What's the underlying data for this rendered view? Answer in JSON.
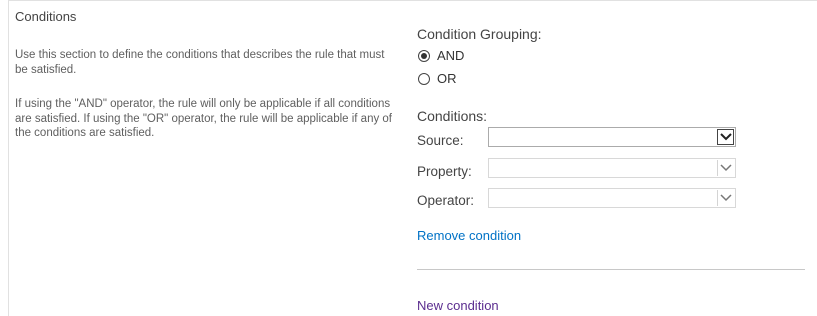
{
  "section": {
    "title": "Conditions",
    "description_1": "Use this section to define the conditions that describes the rule that must be satisfied.",
    "description_2": "If using the \"AND\" operator, the rule will only be applicable if all conditions are satisfied. If using the \"OR\" operator, the rule will be applicable if any of the conditions are satisfied."
  },
  "grouping": {
    "label": "Condition Grouping:",
    "options": [
      {
        "label": "AND",
        "selected": true
      },
      {
        "label": "OR",
        "selected": false
      }
    ]
  },
  "conditions": {
    "label": "Conditions:",
    "fields": {
      "source": {
        "label": "Source:",
        "value": "",
        "enabled": true
      },
      "property": {
        "label": "Property:",
        "value": "",
        "enabled": false
      },
      "operator": {
        "label": "Operator:",
        "value": "",
        "enabled": false
      }
    },
    "remove_link": "Remove condition",
    "new_link": "New condition"
  },
  "icons": {
    "dropdown": "chevron-down-icon",
    "radio_selected": "radio-selected-icon",
    "radio_unselected": "radio-unselected-icon"
  },
  "colors": {
    "link": "#0072c6",
    "visited_link": "#5b2d8f",
    "text": "#444444"
  }
}
